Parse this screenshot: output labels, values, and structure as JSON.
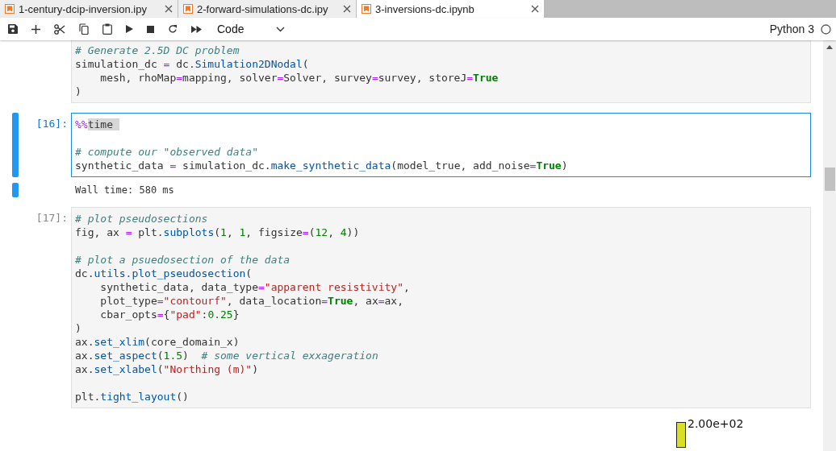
{
  "tabs": [
    {
      "label": "1-century-dcip-inversion.ipy",
      "selected": false
    },
    {
      "label": "2-forward-simulations-dc.ipy",
      "selected": false
    },
    {
      "label": "3-inversions-dc.ipynb",
      "selected": true
    }
  ],
  "toolbar": {
    "cell_type": "Code",
    "kernel": "Python 3"
  },
  "cells": [
    {
      "selected": false,
      "lines": [
        {
          "tokens": [
            {
              "t": "# Generate 2.5D DC problem",
              "kind": "comment"
            }
          ]
        },
        {
          "tokens": [
            {
              "t": "simulation_dc ",
              "kind": "plain"
            },
            {
              "t": "=",
              "kind": "op"
            },
            {
              "t": " dc.",
              "kind": "plain"
            },
            {
              "t": "Simulation2DNodal",
              "kind": "func"
            },
            {
              "t": "(",
              "kind": "plain"
            }
          ]
        },
        {
          "tokens": [
            {
              "t": "    mesh, rhoMap",
              "kind": "plain"
            },
            {
              "t": "=",
              "kind": "op"
            },
            {
              "t": "mapping, solver",
              "kind": "plain"
            },
            {
              "t": "=",
              "kind": "op"
            },
            {
              "t": "Solver, survey",
              "kind": "plain"
            },
            {
              "t": "=",
              "kind": "op"
            },
            {
              "t": "survey, storeJ",
              "kind": "plain"
            },
            {
              "t": "=",
              "kind": "op"
            },
            {
              "t": "True",
              "kind": "keyword"
            }
          ]
        },
        {
          "tokens": [
            {
              "t": ")",
              "kind": "plain"
            }
          ]
        }
      ]
    },
    {
      "selected": true,
      "prompt": "[16]:",
      "output": "Wall time: 580 ms",
      "lines": [
        {
          "tokens": [
            {
              "t": "%%",
              "kind": "magic"
            },
            {
              "t": "time ",
              "kind": "highlight"
            }
          ]
        },
        {
          "kind": "blank"
        },
        {
          "tokens": [
            {
              "t": "# compute our \"observed data\"",
              "kind": "comment"
            }
          ]
        },
        {
          "tokens": [
            {
              "t": "synthetic_data ",
              "kind": "plain"
            },
            {
              "t": "=",
              "kind": "op"
            },
            {
              "t": " simulation_dc.",
              "kind": "plain"
            },
            {
              "t": "make_synthetic_data",
              "kind": "func"
            },
            {
              "t": "(model_true, add_noise",
              "kind": "plain"
            },
            {
              "t": "=",
              "kind": "op"
            },
            {
              "t": "True",
              "kind": "keyword"
            },
            {
              "t": ")",
              "kind": "plain"
            }
          ]
        }
      ]
    },
    {
      "selected": false,
      "prompt": "[17]:",
      "lines": [
        {
          "tokens": [
            {
              "t": "# plot pseudosections",
              "kind": "comment"
            }
          ]
        },
        {
          "tokens": [
            {
              "t": "fig, ax ",
              "kind": "plain"
            },
            {
              "t": "=",
              "kind": "op"
            },
            {
              "t": " plt.",
              "kind": "plain"
            },
            {
              "t": "subplots",
              "kind": "func"
            },
            {
              "t": "(",
              "kind": "plain"
            },
            {
              "t": "1",
              "kind": "number"
            },
            {
              "t": ", ",
              "kind": "plain"
            },
            {
              "t": "1",
              "kind": "number"
            },
            {
              "t": ", figsize",
              "kind": "plain"
            },
            {
              "t": "=",
              "kind": "op"
            },
            {
              "t": "(",
              "kind": "plain"
            },
            {
              "t": "12",
              "kind": "number"
            },
            {
              "t": ", ",
              "kind": "plain"
            },
            {
              "t": "4",
              "kind": "number"
            },
            {
              "t": "))",
              "kind": "plain"
            }
          ]
        },
        {
          "kind": "blank"
        },
        {
          "tokens": [
            {
              "t": "# plot a psuedosection of the data",
              "kind": "comment"
            }
          ]
        },
        {
          "tokens": [
            {
              "t": "dc.",
              "kind": "plain"
            },
            {
              "t": "utils.plot_pseudosection",
              "kind": "func"
            },
            {
              "t": "(",
              "kind": "plain"
            }
          ]
        },
        {
          "tokens": [
            {
              "t": "    synthetic_data, data_type",
              "kind": "plain"
            },
            {
              "t": "=",
              "kind": "op"
            },
            {
              "t": "\"apparent resistivity\"",
              "kind": "string"
            },
            {
              "t": ",",
              "kind": "plain"
            }
          ]
        },
        {
          "tokens": [
            {
              "t": "    plot_type",
              "kind": "plain"
            },
            {
              "t": "=",
              "kind": "op"
            },
            {
              "t": "\"contourf\"",
              "kind": "string"
            },
            {
              "t": ", data_location",
              "kind": "plain"
            },
            {
              "t": "=",
              "kind": "op"
            },
            {
              "t": "True",
              "kind": "keyword"
            },
            {
              "t": ", ax",
              "kind": "plain"
            },
            {
              "t": "=",
              "kind": "op"
            },
            {
              "t": "ax,",
              "kind": "plain"
            }
          ]
        },
        {
          "tokens": [
            {
              "t": "    cbar_opts",
              "kind": "plain"
            },
            {
              "t": "=",
              "kind": "op"
            },
            {
              "t": "{",
              "kind": "plain"
            },
            {
              "t": "\"pad\"",
              "kind": "string"
            },
            {
              "t": ":",
              "kind": "plain"
            },
            {
              "t": "0.25",
              "kind": "number"
            },
            {
              "t": "}",
              "kind": "plain"
            }
          ]
        },
        {
          "tokens": [
            {
              "t": ")",
              "kind": "plain"
            }
          ]
        },
        {
          "tokens": [
            {
              "t": "ax.",
              "kind": "plain"
            },
            {
              "t": "set_xlim",
              "kind": "func"
            },
            {
              "t": "(core_domain_x)",
              "kind": "plain"
            }
          ]
        },
        {
          "tokens": [
            {
              "t": "ax.",
              "kind": "plain"
            },
            {
              "t": "set_aspect",
              "kind": "func"
            },
            {
              "t": "(",
              "kind": "plain"
            },
            {
              "t": "1.5",
              "kind": "number"
            },
            {
              "t": ")  ",
              "kind": "plain"
            },
            {
              "t": "# some vertical exxageration",
              "kind": "comment"
            }
          ]
        },
        {
          "tokens": [
            {
              "t": "ax.",
              "kind": "plain"
            },
            {
              "t": "set_xlabel",
              "kind": "func"
            },
            {
              "t": "(",
              "kind": "plain"
            },
            {
              "t": "\"Northing (m)\"",
              "kind": "string"
            },
            {
              "t": ")",
              "kind": "plain"
            }
          ]
        },
        {
          "kind": "blank"
        },
        {
          "tokens": [
            {
              "t": "plt.",
              "kind": "plain"
            },
            {
              "t": "tight_layout",
              "kind": "func"
            },
            {
              "t": "()",
              "kind": "plain"
            }
          ]
        }
      ]
    }
  ],
  "colorbar": {
    "tick_label": "2.00e+02"
  }
}
